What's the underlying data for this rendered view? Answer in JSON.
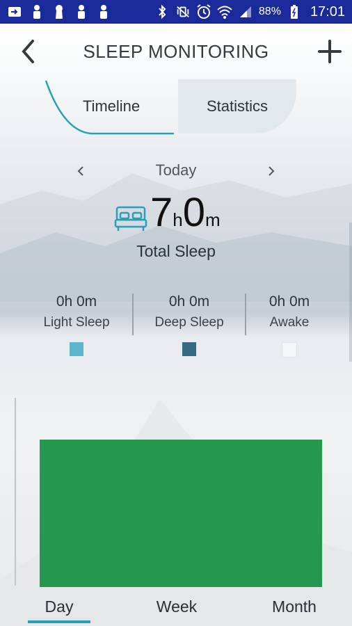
{
  "status_bar": {
    "battery_percent": "88%",
    "time": "17:01",
    "background_color": "#1a2a9a"
  },
  "header": {
    "title": "SLEEP MONITORING"
  },
  "tabs": {
    "timeline": "Timeline",
    "statistics": "Statistics",
    "accent_color": "#2aa0b8"
  },
  "day_nav": {
    "label": "Today"
  },
  "total_sleep": {
    "hours": "7",
    "hours_unit": "h",
    "minutes": "0",
    "minutes_unit": "m",
    "label": "Total Sleep"
  },
  "breakdown": [
    {
      "value": "0h 0m",
      "label": "Light Sleep",
      "color": "#5bb6cc"
    },
    {
      "value": "0h 0m",
      "label": "Deep Sleep",
      "color": "#336a85"
    },
    {
      "value": "0h 0m",
      "label": "Awake",
      "color": "#f4f5f6"
    }
  ],
  "chart": {
    "bar_color": "#26974e"
  },
  "period_tabs": {
    "day": "Day",
    "week": "Week",
    "month": "Month",
    "selected": "Day"
  }
}
